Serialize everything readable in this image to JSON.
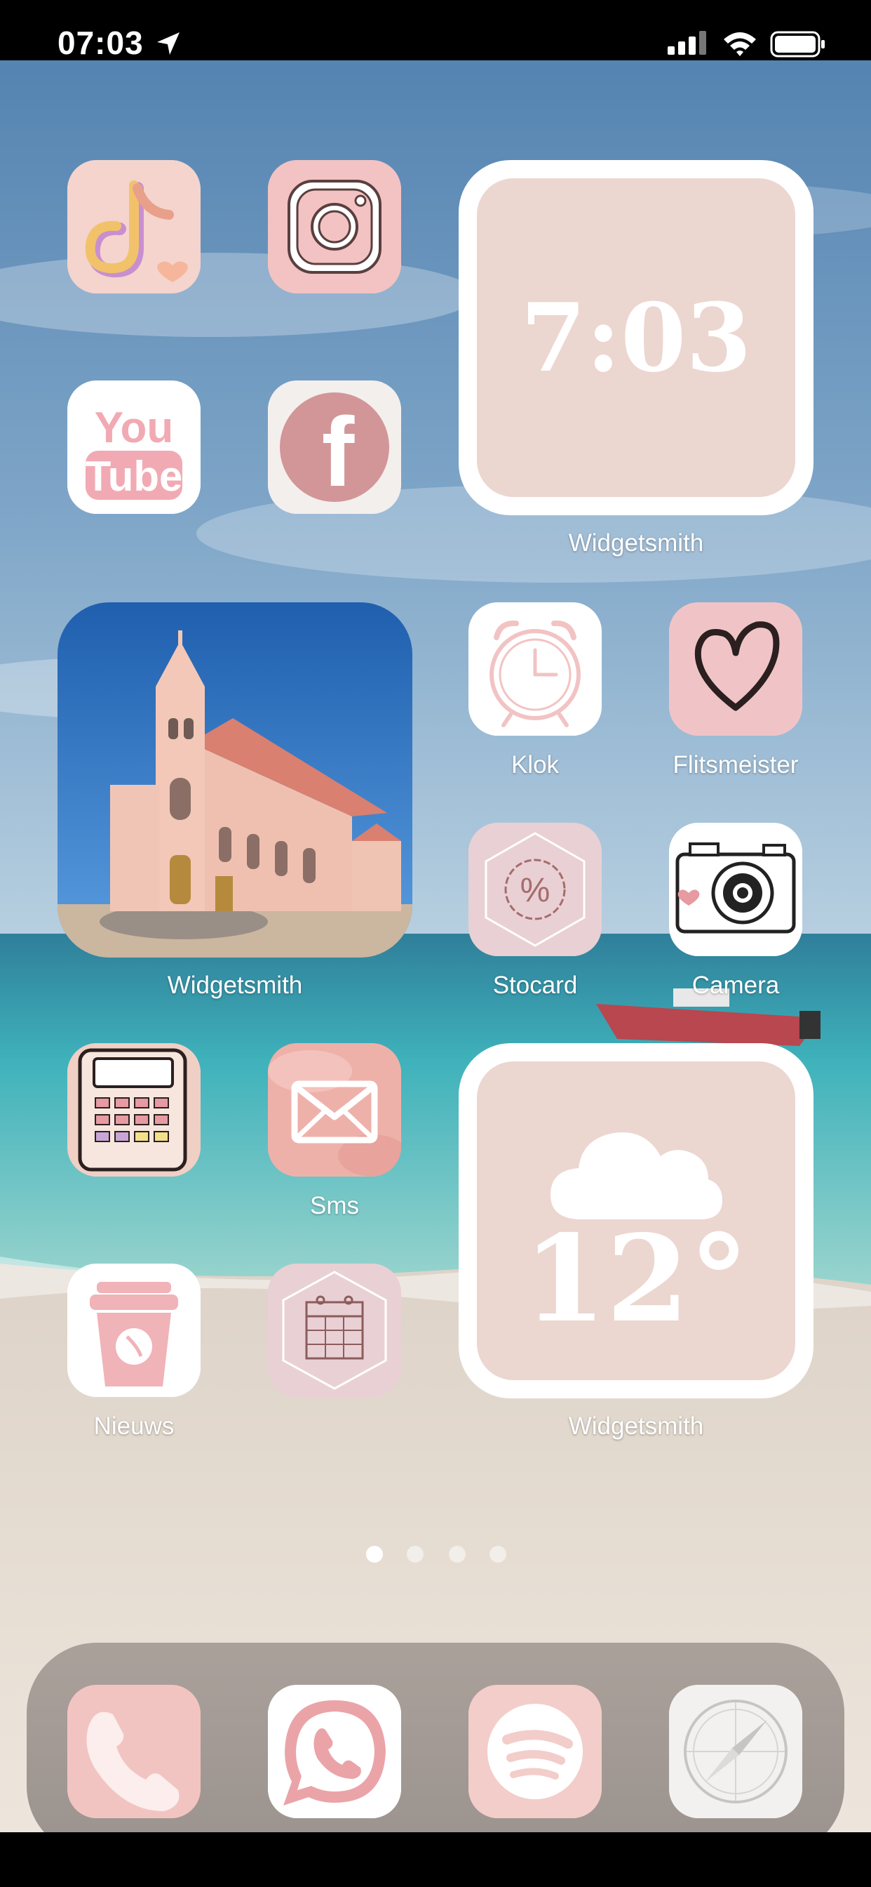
{
  "status_bar": {
    "time": "07:03",
    "location_icon": "location-arrow-icon",
    "signal_icon": "cellular-signal-icon",
    "wifi_icon": "wifi-icon",
    "battery_icon": "battery-icon"
  },
  "colors": {
    "pink_light": "#f3c9c8",
    "pink_widget": "#ecd6d0",
    "sky": "#5f8fb8",
    "sea": "#4fc3c4",
    "sand": "#e9e1d9"
  },
  "apps": {
    "tiktok": {
      "icon": "tiktok-icon"
    },
    "instagram": {
      "icon": "instagram-icon"
    },
    "youtube": {
      "icon": "youtube-icon",
      "logo_line1": "You",
      "logo_line2": "Tube"
    },
    "facebook": {
      "icon": "facebook-icon",
      "logo": "f"
    },
    "clock_app": {
      "icon": "alarm-clock-icon",
      "label": "Klok"
    },
    "flitsmeister": {
      "icon": "heart-icon",
      "label": "Flitsmeister"
    },
    "stocard": {
      "icon": "percent-badge-icon",
      "label": "Stocard",
      "logo": "%"
    },
    "camera": {
      "icon": "camera-icon",
      "label": "Camera"
    },
    "calculator": {
      "icon": "calculator-icon"
    },
    "sms": {
      "icon": "envelope-icon",
      "label": "Sms"
    },
    "nieuws": {
      "icon": "coffee-cup-icon",
      "label": "Nieuws"
    },
    "calendar": {
      "icon": "calendar-icon"
    }
  },
  "widgets": {
    "clock": {
      "time": "7:03",
      "label": "Widgetsmith"
    },
    "photo": {
      "label": "Widgetsmith"
    },
    "weather": {
      "temperature": "12°",
      "icon": "cloud-icon",
      "label": "Widgetsmith"
    }
  },
  "page_dots": {
    "count": 4,
    "active": 1
  },
  "dock": {
    "items": [
      {
        "name": "phone",
        "icon": "phone-icon"
      },
      {
        "name": "whatsapp",
        "icon": "whatsapp-icon"
      },
      {
        "name": "spotify",
        "icon": "spotify-icon"
      },
      {
        "name": "safari",
        "icon": "compass-icon"
      }
    ]
  }
}
